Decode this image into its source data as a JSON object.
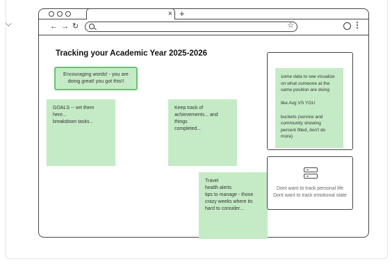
{
  "page": {
    "title": "Tracking your Academic Year 2025-2026"
  },
  "browser": {
    "tab_close": "×",
    "new_tab": "+",
    "nav": {
      "back": "←",
      "forward": "→",
      "reload": "↻"
    },
    "star": "☆",
    "menu": "⋮",
    "icons": [
      "search-icon",
      "star-icon",
      "profile-icon",
      "kebab-menu-icon",
      "server-icon"
    ]
  },
  "stickies": {
    "encourage": "Encouraging words! - you are doing great! you got this!!",
    "goals": [
      "GOALS -- set them here...",
      "breakdown tasks..."
    ],
    "keep": [
      "Keep track of",
      "achievements... and things",
      "completed..."
    ],
    "travel": [
      "Travel",
      "health alerts",
      "tips to manage - those",
      "crazy weeks where its",
      "hard to consider..."
    ],
    "data": {
      "p1": [
        "some data to see visualize",
        "on what someone at the",
        "same position are doing"
      ],
      "p2": "like Avg VS YOU",
      "p3": [
        "buckets (service and",
        "community showing",
        "percent filled, don't do",
        "more)"
      ]
    }
  },
  "privacy_panel": {
    "line1": "Dont want to track personal life",
    "line2": "Dont want to track emotional state"
  },
  "colors": {
    "sticky": "#c5ebc6",
    "sticky_border": "#6cc070",
    "frame": "#444444"
  }
}
